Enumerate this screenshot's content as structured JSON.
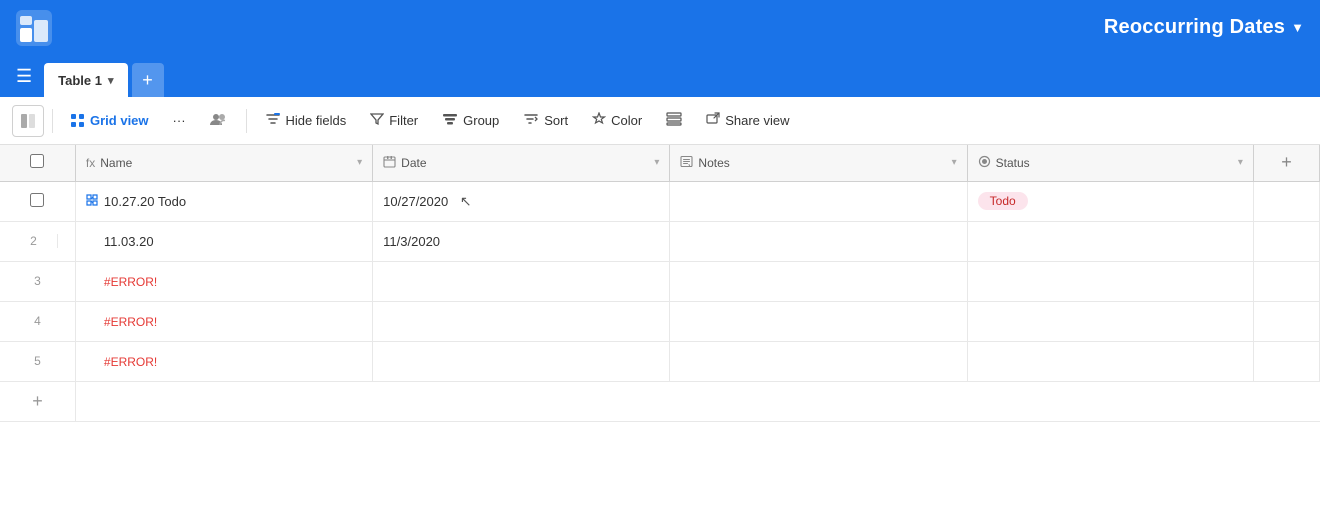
{
  "app": {
    "title": "Reoccurring Dates",
    "title_arrow": "▼",
    "logo_alt": "Airtable logo"
  },
  "tabs": [
    {
      "label": "Table 1",
      "active": true
    }
  ],
  "toolbar": {
    "sidebar_toggle_icon": "▣",
    "grid_view_label": "Grid view",
    "more_icon": "···",
    "team_icon": "👥",
    "hide_fields_label": "Hide fields",
    "filter_label": "Filter",
    "group_label": "Group",
    "sort_label": "Sort",
    "color_label": "Color",
    "row_height_label": "≡",
    "share_view_label": "Share view"
  },
  "table": {
    "columns": [
      {
        "id": "name",
        "icon": "fx",
        "label": "Name",
        "has_dropdown": true
      },
      {
        "id": "date",
        "icon": "📅",
        "label": "Date",
        "has_dropdown": true
      },
      {
        "id": "notes",
        "icon": "≡A",
        "label": "Notes",
        "has_dropdown": true
      },
      {
        "id": "status",
        "icon": "◎",
        "label": "Status",
        "has_dropdown": true
      }
    ],
    "rows": [
      {
        "num": "",
        "expand": true,
        "name": "10.27.20 Todo",
        "date": "10/27/2020",
        "notes": "",
        "status": "Todo",
        "status_type": "todo",
        "is_first": true
      },
      {
        "num": "2",
        "expand": false,
        "name": "11.03.20",
        "date": "11/3/2020",
        "notes": "",
        "status": "",
        "status_type": ""
      },
      {
        "num": "3",
        "expand": false,
        "name": "#ERROR!",
        "date": "",
        "notes": "",
        "status": "",
        "status_type": "",
        "is_error": true
      },
      {
        "num": "4",
        "expand": false,
        "name": "#ERROR!",
        "date": "",
        "notes": "",
        "status": "",
        "status_type": "",
        "is_error": true
      },
      {
        "num": "5",
        "expand": false,
        "name": "#ERROR!",
        "date": "",
        "notes": "",
        "status": "",
        "status_type": "",
        "is_error": true
      }
    ],
    "add_row_label": "+",
    "add_col_label": "+"
  }
}
